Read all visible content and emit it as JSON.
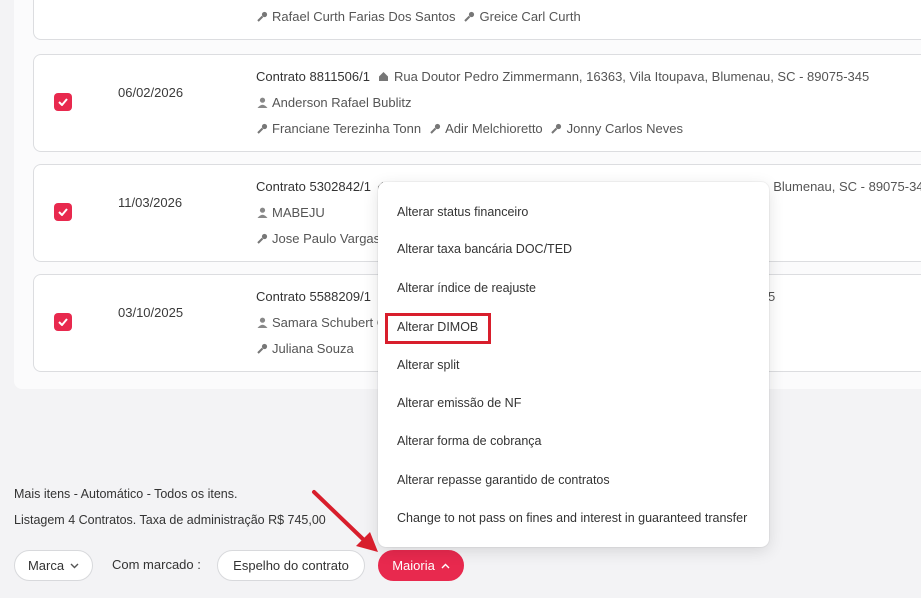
{
  "contracts": [
    {
      "checked": true,
      "date": "",
      "contract": "",
      "address": "",
      "owner": "",
      "tenants": [
        "Rafael Curth Farias Dos Santos",
        "Greice Carl Curth"
      ]
    },
    {
      "checked": true,
      "date": "06/02/2026",
      "contract": "Contrato 8811506/1",
      "address": "Rua Doutor Pedro Zimmermann, 16363, Vila Itoupava, Blumenau, SC - 89075-345",
      "owner": "Anderson Rafael Bublitz",
      "tenants": [
        "Franciane Terezinha Tonn",
        "Adir Melchioretto",
        "Jonny Carlos Neves"
      ]
    },
    {
      "checked": true,
      "date": "11/03/2026",
      "contract": "Contrato 5302842/1",
      "address": ", Blumenau, SC - 89075-34",
      "owner": "MABEJU",
      "tenants": [
        "Jose Paulo Vargas C"
      ]
    },
    {
      "checked": true,
      "date": "03/10/2025",
      "contract": "Contrato 5588209/1",
      "address": "5",
      "owner": "Samara Schubert C",
      "tenants": [
        "Juliana Souza"
      ]
    }
  ],
  "footer": {
    "line1": "Mais itens - Automático - Todos os itens.",
    "line2": "Listagem 4 Contratos. Taxa de administração R$ 745,00",
    "brand_button": "Marca",
    "with_checked_label": "Com marcado :",
    "mirror_button": "Espelho do contrato",
    "more_button": "Maioria"
  },
  "menu": {
    "items": [
      "Alterar status financeiro",
      "Alterar taxa bancária DOC/TED",
      "Alterar índice de reajuste",
      "Alterar DIMOB",
      "Alterar split",
      "Alterar emissão de NF",
      "Alterar forma de cobrança",
      "Alterar repasse garantido de contratos",
      "Change to not pass on fines and interest in guaranteed transfer"
    ],
    "highlighted": "Alterar DIMOB"
  },
  "colors": {
    "accent": "#e8294e",
    "highlight": "#d81e2c"
  },
  "icons": {
    "checkbox": "check-icon",
    "address": "home-icon",
    "owner": "person-icon",
    "tenant": "key-icon",
    "chevron": "chevron-down-icon",
    "chevron_up": "chevron-up-icon",
    "annotation": "red-arrow"
  }
}
